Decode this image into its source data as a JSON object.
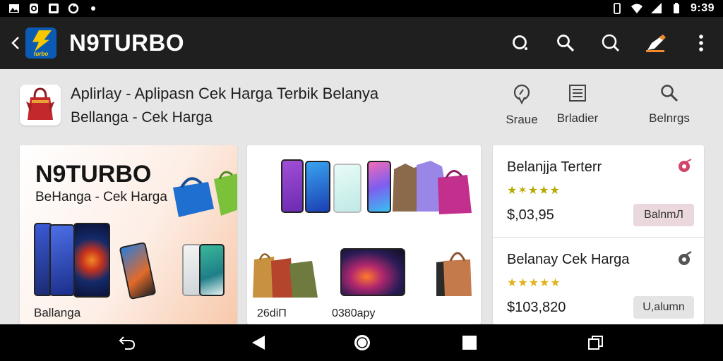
{
  "status_bar": {
    "time": "9:39",
    "left_icons": [
      "photo-icon",
      "alarm-icon",
      "gallery-icon",
      "sync-icon",
      "dot-icon"
    ],
    "right_icons": [
      "vibrate-icon",
      "wifi-icon",
      "signal-icon",
      "battery-icon"
    ]
  },
  "app_bar": {
    "title": "N9TURBO",
    "logo_text": "turbo",
    "actions": [
      "search-circle-icon",
      "search-icon",
      "search-outline-icon",
      "edit-icon",
      "more-vert-icon"
    ]
  },
  "app_info": {
    "title": "Aplirlay - Aplipasn Cek Harga Terbik Belanya",
    "subtitle": "Bellanga - Cek Harga",
    "actions": [
      {
        "label": "Sraue",
        "icon": "location-pin-icon"
      },
      {
        "label": "Brladier",
        "icon": "list-icon"
      },
      {
        "label": "Belnrgs",
        "icon": "search-icon"
      }
    ]
  },
  "banner": {
    "title": "N9TURBO",
    "subtitle": "BeHanga - Cek Harga",
    "footer": "Ballanga"
  },
  "grid": {
    "caption_left": "26diП",
    "caption_right": "0380apy"
  },
  "products": [
    {
      "name": "Belanjja Terterr",
      "rating": "★✶★★★",
      "price": "$,03,95",
      "button": "BalnmЛ",
      "accent": "#d2456a"
    },
    {
      "name": "Belanay Cek Harga",
      "rating": "★★★★★",
      "price": "$103,820",
      "button": "U,alumn",
      "accent": "#555555"
    }
  ],
  "nav_bar": {
    "buttons": [
      "back-nav-icon",
      "back-triangle-icon",
      "home-icon",
      "recents-icon",
      "split-screen-icon"
    ]
  },
  "colors": {
    "app_bar": "#1f1f1f",
    "background": "#e6e6e6",
    "star": "#b7a800",
    "buy_button": "#ead8dd"
  }
}
